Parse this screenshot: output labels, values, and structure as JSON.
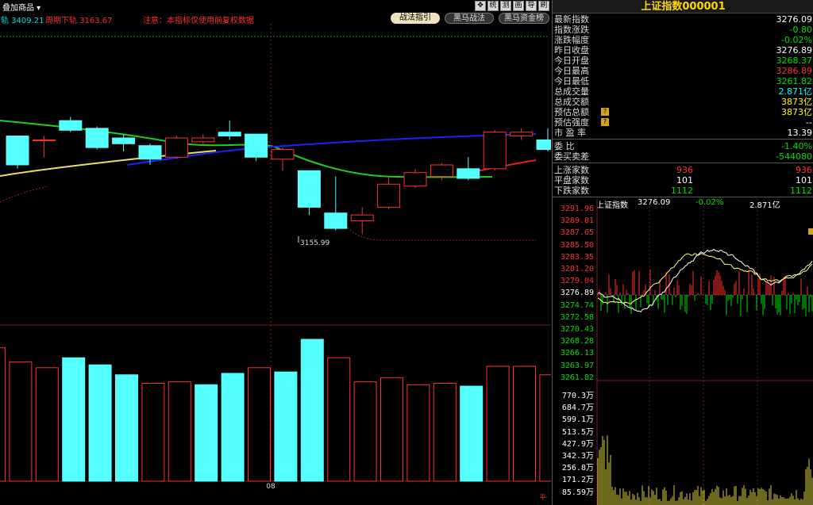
{
  "topbar": {
    "overlay_menu": "叠加商品",
    "upper_band": "轨 3409.21",
    "lower_band": "周期下轨 3163.67",
    "notice": "注意：本指标仅使用前复权数据",
    "buttons": [
      "战法指引",
      "黑马战法",
      "黑马资金榜"
    ],
    "tools": [
      "✥",
      "统",
      "测",
      "画",
      "导",
      "刷"
    ]
  },
  "kchart": {
    "low_label": "3155.99",
    "date_label": "08",
    "corner": "平·"
  },
  "quote": {
    "title_name": "上证指数",
    "title_code": "000001",
    "rows": [
      {
        "label": "最新指数",
        "value": "3276.09",
        "color": "white"
      },
      {
        "label": "指数涨跌",
        "value": "-0.80",
        "color": "down"
      },
      {
        "label": "涨跌幅度",
        "value": "-0.02%",
        "color": "down"
      },
      {
        "label": "昨日收盘",
        "value": "3276.89",
        "color": "white"
      },
      {
        "label": "今日开盘",
        "value": "3268.37",
        "color": "down"
      },
      {
        "label": "今日最高",
        "value": "3286.89",
        "color": "up"
      },
      {
        "label": "今日最低",
        "value": "3261.82",
        "color": "down"
      },
      {
        "label": "总成交量",
        "value": "2.871亿",
        "color": "cyan"
      },
      {
        "label": "总成交额",
        "value": "3873亿",
        "color": "yellow"
      },
      {
        "label": "预估总额",
        "value": "3873亿",
        "color": "yellow",
        "mark": "?"
      },
      {
        "label": "预估强度",
        "value": "--",
        "color": "white",
        "mark": "?"
      },
      {
        "label": "市 盈 率",
        "value": "13.39",
        "color": "white"
      }
    ],
    "ratio_label": "委  比",
    "ratio_value": "-1.40%",
    "diff_label": "委买卖差",
    "diff_value": "-544080",
    "breadth": [
      {
        "label": "上涨家数",
        "mid": "936",
        "value": "936",
        "color": "up"
      },
      {
        "label": "平盘家数",
        "mid": "101",
        "value": "101",
        "color": "white"
      },
      {
        "label": "下跌家数",
        "mid": "1112",
        "value": "1112",
        "color": "down"
      }
    ]
  },
  "mini": {
    "name": "上证指数",
    "price": "3276.09",
    "pct": "-0.02%",
    "vol": "2.871亿",
    "price_labels": [
      "3291.96",
      "3289.81",
      "3287.65",
      "3285.50",
      "3283.35",
      "3281.20",
      "3279.04",
      "3276.89",
      "3274.74",
      "3272.58",
      "3270.43",
      "3268.28",
      "3266.13",
      "3263.97",
      "3261.82"
    ],
    "vol_labels": [
      "770.3万",
      "684.7万",
      "599.1万",
      "513.5万",
      "427.9万",
      "342.3万",
      "256.8万",
      "171.2万",
      "85.59万"
    ]
  },
  "colors": {
    "up": "#ff3030",
    "down": "#00e000",
    "cyan_bar": "#54ffff",
    "ma_green": "#22cc22",
    "ma_blue": "#2020ff",
    "ma_red": "#e02020",
    "ma_yellow": "#e8e060"
  },
  "chart_data": {
    "type": "candlestick",
    "candles": [
      {
        "o": 3283,
        "c": 3268,
        "h": 3283,
        "l": 3266
      },
      {
        "o": 3281,
        "c": 3281,
        "h": 3283,
        "l": 3272
      },
      {
        "o": 3291,
        "c": 3286,
        "h": 3293,
        "l": 3285
      },
      {
        "o": 3287,
        "c": 3277,
        "h": 3288,
        "l": 3276
      },
      {
        "o": 3282,
        "c": 3279,
        "h": 3284,
        "l": 3275
      },
      {
        "o": 3278,
        "c": 3271,
        "h": 3279,
        "l": 3268
      },
      {
        "o": 3272,
        "c": 3282,
        "h": 3283,
        "l": 3271
      },
      {
        "o": 3280,
        "c": 3282,
        "h": 3284,
        "l": 3279
      },
      {
        "o": 3285,
        "c": 3283,
        "h": 3291,
        "l": 3281
      },
      {
        "o": 3284,
        "c": 3272,
        "h": 3284,
        "l": 3270
      },
      {
        "o": 3271,
        "c": 3276,
        "h": 3277,
        "l": 3265
      },
      {
        "o": 3265,
        "c": 3246,
        "h": 3265,
        "l": 3242
      },
      {
        "o": 3243,
        "c": 3235,
        "h": 3262,
        "l": 3234
      },
      {
        "o": 3239,
        "c": 3242,
        "h": 3246,
        "l": 3232
      },
      {
        "o": 3246,
        "c": 3258,
        "h": 3262,
        "l": 3245
      },
      {
        "o": 3257,
        "c": 3264,
        "h": 3266,
        "l": 3256
      },
      {
        "o": 3262,
        "c": 3268,
        "h": 3269,
        "l": 3260
      },
      {
        "o": 3266,
        "c": 3261,
        "h": 3272,
        "l": 3260
      },
      {
        "o": 3266,
        "c": 3285,
        "h": 3286,
        "l": 3265
      },
      {
        "o": 3283,
        "c": 3285,
        "h": 3287,
        "l": 3281
      },
      {
        "o": 3281,
        "c": 3276,
        "h": 3287,
        "l": 3275
      }
    ],
    "volumes": [
      94,
      84,
      80,
      87,
      82,
      75,
      69,
      70,
      68,
      76,
      80,
      77,
      100,
      87,
      70,
      73,
      68,
      69,
      67,
      81,
      81,
      75
    ],
    "volume_colors": [
      "up",
      "up",
      "up",
      "down",
      "down",
      "down",
      "up",
      "up",
      "down",
      "down",
      "up",
      "down",
      "down",
      "up",
      "up",
      "up",
      "up",
      "up",
      "down",
      "up",
      "up",
      "up"
    ]
  }
}
